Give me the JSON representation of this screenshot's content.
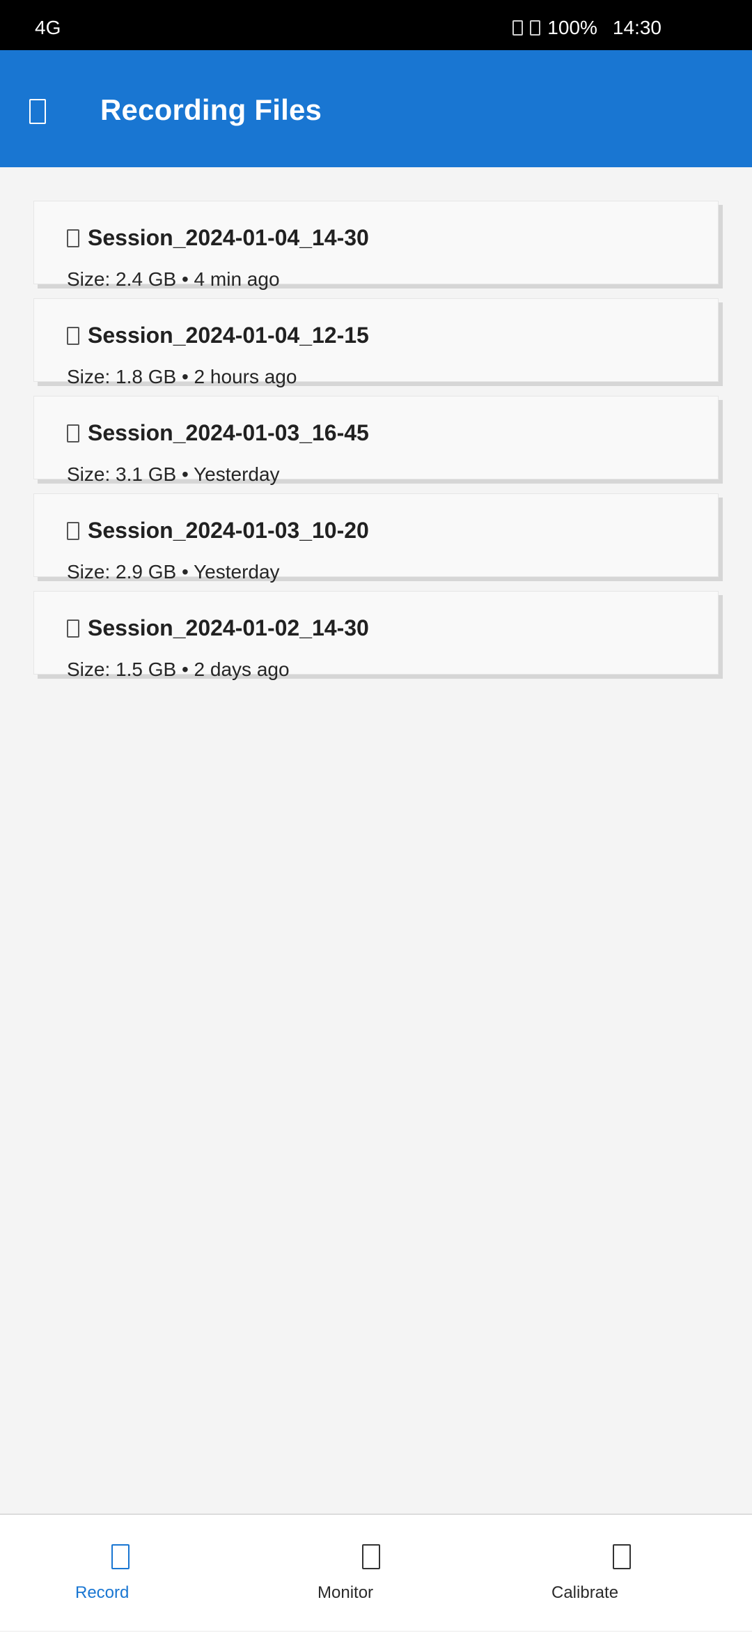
{
  "status_bar": {
    "network": "4G",
    "battery": "100%",
    "time": "14:30",
    "icons": [
      "wifi-icon",
      "battery-icon"
    ]
  },
  "app_bar": {
    "nav_icon": "menu-icon",
    "title": "Recording Files"
  },
  "files": [
    {
      "icon": "file-icon",
      "name": "Session_2024-01-04_14-30",
      "meta": "Size: 2.4 GB • 4 min ago"
    },
    {
      "icon": "file-icon",
      "name": "Session_2024-01-04_12-15",
      "meta": "Size: 1.8 GB • 2 hours ago"
    },
    {
      "icon": "file-icon",
      "name": "Session_2024-01-03_16-45",
      "meta": "Size: 3.1 GB • Yesterday"
    },
    {
      "icon": "file-icon",
      "name": "Session_2024-01-03_10-20",
      "meta": "Size: 2.9 GB • Yesterday"
    },
    {
      "icon": "file-icon",
      "name": "Session_2024-01-02_14-30",
      "meta": "Size: 1.5 GB • 2 days ago"
    }
  ],
  "bottom_nav": {
    "items": [
      {
        "icon": "record-icon",
        "label": "Record",
        "active": true
      },
      {
        "icon": "monitor-icon",
        "label": "Monitor",
        "active": false
      },
      {
        "icon": "calibrate-icon",
        "label": "Calibrate",
        "active": false
      }
    ]
  },
  "colors": {
    "primary": "#1976d2",
    "status_bar": "#000000",
    "background": "#f4f4f4",
    "card": "#f9f9f9"
  }
}
